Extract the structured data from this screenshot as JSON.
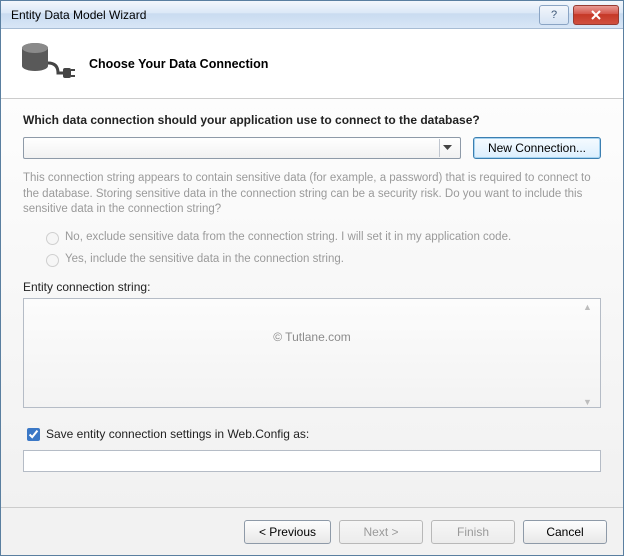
{
  "window": {
    "title": "Entity Data Model Wizard"
  },
  "header": {
    "heading": "Choose Your Data Connection"
  },
  "main": {
    "prompt": "Which data connection should your application use to connect to the database?",
    "connection_value": "",
    "new_connection_label": "New Connection...",
    "sensitive_info": "This connection string appears to contain sensitive data (for example, a password) that is required to connect to the database. Storing sensitive data in the connection string can be a security risk. Do you want to include this sensitive data in the connection string?",
    "radio_exclude": "No, exclude sensitive data from the connection string. I will set it in my application code.",
    "radio_include": "Yes, include the sensitive data in the connection string.",
    "entity_string_label": "Entity connection string:",
    "entity_string_value": "",
    "watermark": "© Tutlane.com",
    "save_checkbox_label": "Save entity connection settings in Web.Config as:",
    "save_checkbox_checked": true,
    "save_name_value": ""
  },
  "footer": {
    "previous": "< Previous",
    "next": "Next >",
    "finish": "Finish",
    "cancel": "Cancel"
  }
}
